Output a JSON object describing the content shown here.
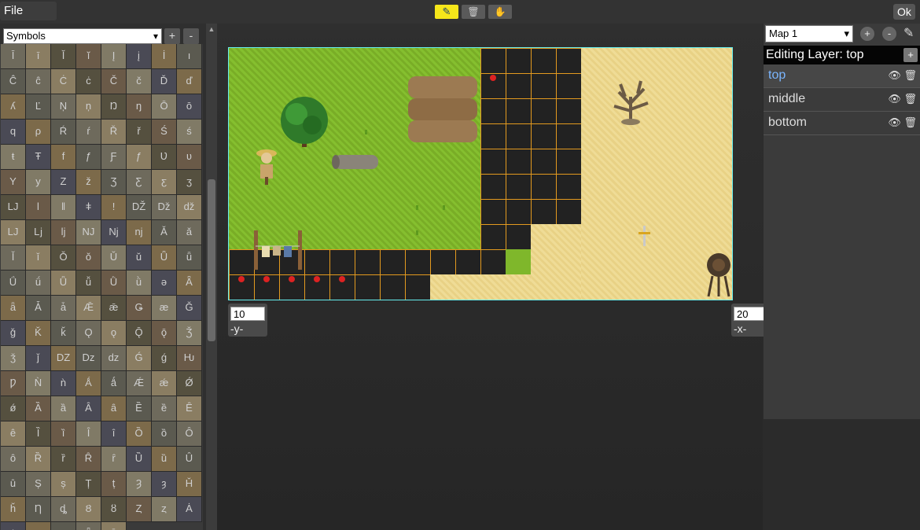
{
  "menu": {
    "file_label": "File"
  },
  "toolbar": {
    "tools": [
      "pencil-tool",
      "eraser-tool",
      "pan-tool"
    ],
    "ok_label": "Ok"
  },
  "tileset": {
    "selected": "Symbols",
    "add_label": "+",
    "remove_label": "-",
    "glyphs": [
      "Ī",
      "ī",
      "Ĭ",
      "ĭ",
      "Į",
      "į",
      "İ",
      "ı",
      "Ĉ",
      "ĉ",
      "Ċ",
      "ċ",
      "Č",
      "č",
      "Ď",
      "ď",
      "ʎ",
      "Ľ",
      "Ņ",
      "ņ",
      "Ŋ",
      "ŋ",
      "Ō",
      "ō",
      "q",
      "ρ",
      "Ŕ",
      "ŕ",
      "Ř",
      "ř",
      "Ś",
      "ś",
      "ŧ",
      "Ŧ",
      "f",
      "ƒ",
      "Ƒ",
      "ƒ",
      "Ʋ",
      "ʋ",
      "Y",
      "y",
      "Z",
      "ž",
      "Ʒ",
      "Ƹ",
      "ƹ",
      "ʒ",
      "Ǉ",
      "ǀ",
      "ǁ",
      "ǂ",
      "ǃ",
      "Ǆ",
      "ǅ",
      "ǆ",
      "Ǉ",
      "ǈ",
      "ǉ",
      "Ǌ",
      "ǋ",
      "ǌ",
      "Ǎ",
      "ǎ",
      "Ǐ",
      "ǐ",
      "Ǒ",
      "ǒ",
      "Ǔ",
      "ǔ",
      "Ǖ",
      "ǖ",
      "Ǘ",
      "ǘ",
      "Ǚ",
      "ǚ",
      "Ǜ",
      "ǜ",
      "ǝ",
      "Ǟ",
      "ǟ",
      "Ǡ",
      "ǡ",
      "Ǣ",
      "ǣ",
      "Ǥ",
      "æ",
      "Ǧ",
      "ǧ",
      "Ǩ",
      "ǩ",
      "Ǫ",
      "ǫ",
      "Ǭ",
      "ǭ",
      "Ǯ",
      "ǯ",
      "ǰ",
      "Ǳ",
      "ǲ",
      "ǳ",
      "Ǵ",
      "ǵ",
      "Ƕ",
      "Ƿ",
      "Ǹ",
      "ǹ",
      "Ǻ",
      "ǻ",
      "Ǽ",
      "ǽ",
      "Ǿ",
      "ǿ",
      "Ȁ",
      "ȁ",
      "Ȃ",
      "ȃ",
      "Ȅ",
      "ȅ",
      "Ȇ",
      "ȇ",
      "Ȉ",
      "ȉ",
      "Ȋ",
      "ȋ",
      "Ȍ",
      "ȍ",
      "Ȏ",
      "ȏ",
      "Ȑ",
      "ȑ",
      "Ȓ",
      "ȓ",
      "Ȕ",
      "ȕ",
      "Ȗ",
      "ȗ",
      "Ș",
      "ș",
      "Ț",
      "ț",
      "Ȝ",
      "ȝ",
      "Ȟ",
      "ȟ",
      "Ƞ",
      "ȡ",
      "Ȣ",
      "ȣ",
      "Ȥ",
      "ȥ",
      "Ȧ",
      "ȧ",
      "Ȩ",
      "ȩ",
      "Ȫ",
      "ȫ"
    ]
  },
  "map": {
    "y_value": "10",
    "y_label": "-y-",
    "x_value": "20",
    "x_label": "-x-"
  },
  "maps_panel": {
    "selected_map": "Map 1",
    "add_label": "+",
    "remove_label": "-",
    "editing_label": "Editing Layer: top",
    "add_layer_label": "+",
    "layers": [
      {
        "name": "top",
        "active": true
      },
      {
        "name": "middle",
        "active": false
      },
      {
        "name": "bottom",
        "active": false
      }
    ]
  },
  "colors": {
    "active_tool": "#f5e61a",
    "active_layer_text": "#7ab6ff",
    "grid_line": "#e39a1f",
    "map_border": "#66eeee"
  }
}
